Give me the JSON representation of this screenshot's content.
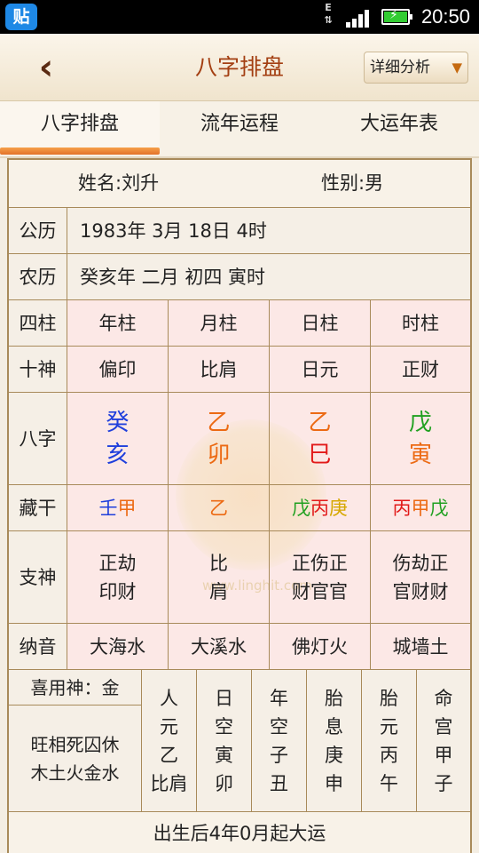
{
  "status_bar": {
    "app_icon_label": "贴",
    "network_label": "E",
    "time": "20:50"
  },
  "header": {
    "title": "八字排盘",
    "detail_button": "详细分析"
  },
  "tabs": [
    {
      "label": "八字排盘"
    },
    {
      "label": "流年运程"
    },
    {
      "label": "大运年表"
    }
  ],
  "person": {
    "name": "姓名:刘升",
    "gender": "性别:男"
  },
  "calendar": {
    "gregorian_label": "公历",
    "gregorian_value": "1983年 3月 18日 4时",
    "lunar_label": "农历",
    "lunar_value": "癸亥年 二月 初四 寅时"
  },
  "pillars": {
    "row_label": "四柱",
    "columns": [
      "年柱",
      "月柱",
      "日柱",
      "时柱"
    ]
  },
  "shishen": {
    "row_label": "十神",
    "values": [
      "偏印",
      "比肩",
      "日元",
      "正财"
    ]
  },
  "bazi": {
    "row_label": "八字",
    "pillars": [
      {
        "stem": "癸",
        "branch": "亥"
      },
      {
        "stem": "乙",
        "branch": "卯"
      },
      {
        "stem": "乙",
        "branch": "巳"
      },
      {
        "stem": "戊",
        "branch": "寅"
      }
    ]
  },
  "canggan": {
    "row_label": "藏干",
    "values": [
      [
        "壬",
        "甲"
      ],
      [
        "乙"
      ],
      [
        "戊",
        "丙",
        "庚"
      ],
      [
        "丙",
        "甲",
        "戊"
      ]
    ]
  },
  "zhishen": {
    "row_label": "支神",
    "values": [
      [
        "正劫",
        "印财"
      ],
      [
        "比",
        "肩"
      ],
      [
        "正伤正",
        "财官官"
      ],
      [
        "伤劫正",
        "官财财"
      ]
    ]
  },
  "nayin": {
    "row_label": "纳音",
    "values": [
      "大海水",
      "大溪水",
      "佛灯火",
      "城墙土"
    ]
  },
  "bottom": {
    "xiyongshen": "喜用神：金",
    "wangxiang_line1": "旺相死囚休",
    "wangxiang_line2": "木土火金水",
    "columns": [
      [
        "人",
        "元",
        "乙",
        "比肩"
      ],
      [
        "日",
        "空",
        "寅",
        "卯"
      ],
      [
        "年",
        "空",
        "子",
        "丑"
      ],
      [
        "胎",
        "息",
        "庚",
        "申"
      ],
      [
        "胎",
        "元",
        "丙",
        "午"
      ],
      [
        "命",
        "宫",
        "甲",
        "子"
      ]
    ],
    "dayun_start": "出生后4年0月起大运"
  },
  "watermark": {
    "text": "www.linghit.com"
  },
  "colors": {
    "water": "#1f3fdc",
    "wood": "#20a020",
    "fire": "#e21a1a",
    "earth": "#d6a800",
    "metal_orange": "#ec6a14",
    "accent": "#a33f12",
    "tab_indicator": "#e2722a",
    "table_bg": "#fce8e6"
  }
}
